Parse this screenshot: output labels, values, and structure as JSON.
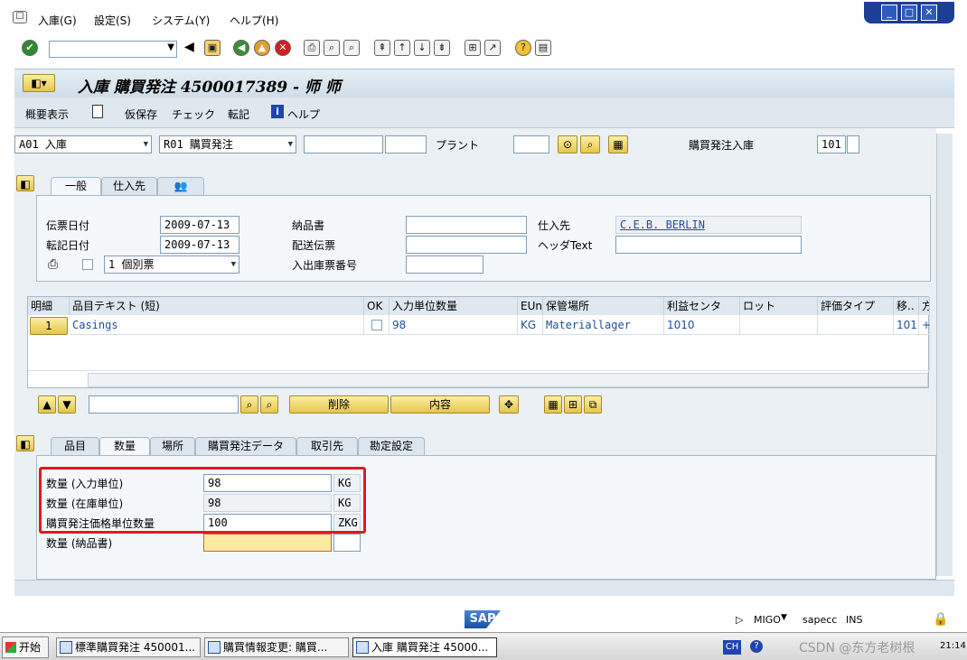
{
  "menu": [
    "入庫(G)",
    "設定(S)",
    "システム(Y)",
    "ヘルプ(H)"
  ],
  "title": "入庫 購買発注 4500017389 - 师 师",
  "appbar": [
    "概要表示",
    "仮保存",
    "チェック",
    "転記",
    "ヘルプ"
  ],
  "header": {
    "action": "A01 入庫",
    "reference": "R01 購買発注",
    "plant_label": "プラント",
    "po_gr_label": "購買発注入庫",
    "movement_type": "101"
  },
  "tabs_header": [
    "一般",
    "仕入先"
  ],
  "general": {
    "doc_date_label": "伝票日付",
    "doc_date": "2009-07-13",
    "post_date_label": "転記日付",
    "post_date": "2009-07-13",
    "slip_option": "1 個別票",
    "delivery_note_label": "納品書",
    "bill_of_lading_label": "配送伝票",
    "gr_slip_label": "入出庫票番号",
    "vendor_label": "仕入先",
    "vendor_value": "C.E.B. BERLIN",
    "header_text_label": "ヘッダText"
  },
  "grid": {
    "headers": [
      "明細",
      "品目テキスト (短)",
      "OK",
      "入力単位数量",
      "EUn",
      "保管場所",
      "利益センタ",
      "ロット",
      "評価タイプ",
      "移..",
      "方"
    ],
    "rows": [
      {
        "item": "1",
        "text": "Casings",
        "qty": "98",
        "eun": "KG",
        "sloc": "Materiallager",
        "pctr": "1010",
        "mvt": "101",
        "dir": "+"
      }
    ]
  },
  "item_buttons": {
    "delete": "削除",
    "content": "内容"
  },
  "tabs_detail": [
    "品目",
    "数量",
    "場所",
    "購買発注データ",
    "取引先",
    "勘定設定"
  ],
  "quantity": {
    "rows": [
      {
        "label": "数量 (入力単位)",
        "value": "98",
        "unit": "KG"
      },
      {
        "label": "数量 (在庫単位)",
        "value": "98",
        "unit": "KG"
      },
      {
        "label": "購買発注価格単位数量",
        "value": "100",
        "unit": "ZKG"
      },
      {
        "label": "数量 (納品書)",
        "value": "",
        "unit": ""
      }
    ]
  },
  "status": {
    "logo": "SAP",
    "transaction": "MIGO",
    "system": "sapecc",
    "mode": "INS"
  },
  "taskbar": {
    "start": "开始",
    "tasks": [
      "標準購買発注 450001...",
      "購買情報変更: 購買...",
      "入庫 購買発注 45000..."
    ],
    "lang": "CH",
    "clock": "21:14",
    "watermark": "CSDN @东方老树根"
  }
}
